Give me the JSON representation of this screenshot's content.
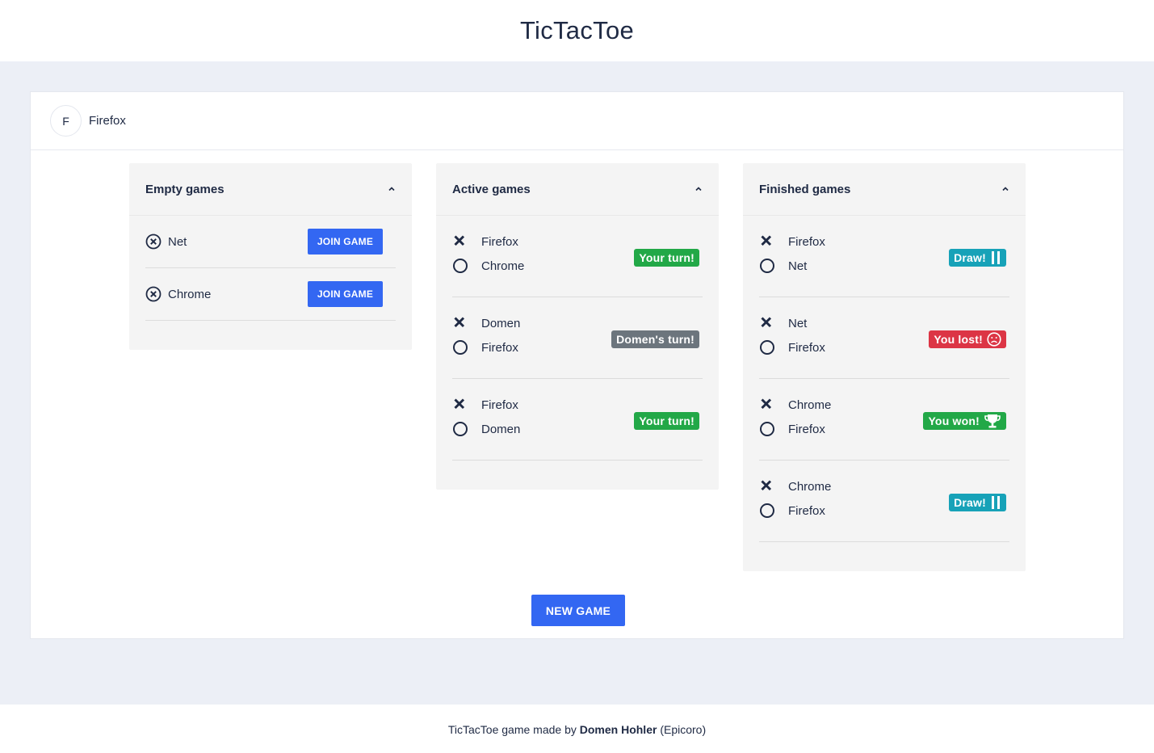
{
  "app": {
    "title": "TicTacToe"
  },
  "user": {
    "initial": "F",
    "name": "Firefox"
  },
  "panels": {
    "empty": {
      "title": "Empty games",
      "join_label": "JOIN GAME",
      "games": [
        {
          "player": "Net"
        },
        {
          "player": "Chrome"
        }
      ]
    },
    "active": {
      "title": "Active games",
      "games": [
        {
          "x": "Firefox",
          "o": "Chrome",
          "status": "Your turn!",
          "status_color": "#22a847"
        },
        {
          "x": "Domen",
          "o": "Firefox",
          "status": "Domen's turn!",
          "status_color": "#6c757d"
        },
        {
          "x": "Firefox",
          "o": "Domen",
          "status": "Your turn!",
          "status_color": "#22a847"
        }
      ]
    },
    "finished": {
      "title": "Finished games",
      "games": [
        {
          "x": "Firefox",
          "o": "Net",
          "status": "Draw!",
          "icon": "pause-icon",
          "status_color": "#17a2b8"
        },
        {
          "x": "Net",
          "o": "Firefox",
          "status": "You lost!",
          "icon": "sad-face-icon",
          "status_color": "#dc3545"
        },
        {
          "x": "Chrome",
          "o": "Firefox",
          "status": "You won!",
          "icon": "trophy-icon",
          "status_color": "#22a847"
        },
        {
          "x": "Chrome",
          "o": "Firefox",
          "status": "Draw!",
          "icon": "pause-icon",
          "status_color": "#17a2b8"
        }
      ]
    }
  },
  "new_game_label": "NEW GAME",
  "footer": {
    "prefix": "TicTacToe game made by",
    "author": "Domen Hohler",
    "alias": "(Epicoro)"
  },
  "colors": {
    "primary": "#3367f2",
    "text": "#1f2a44",
    "background": "#eceff6"
  }
}
